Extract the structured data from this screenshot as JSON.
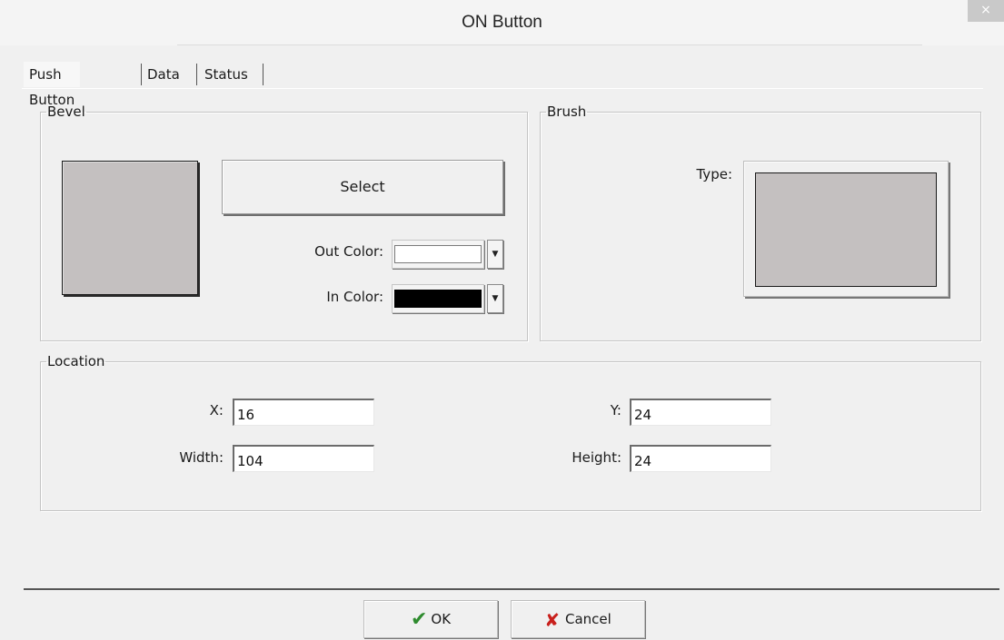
{
  "window": {
    "title": "ON Button",
    "close_glyph": "×"
  },
  "tabs": [
    {
      "label": "Push Button",
      "active": true
    },
    {
      "label": "Data",
      "active": false
    },
    {
      "label": "Status",
      "active": false
    }
  ],
  "bevel": {
    "legend": "Bevel",
    "select_label": "Select",
    "out_color_label": "Out Color:",
    "in_color_label": "In Color:",
    "out_color": "#ffffff",
    "in_color": "#000000",
    "preview_color": "#c4c0c0"
  },
  "brush": {
    "legend": "Brush",
    "type_label": "Type:",
    "type_color": "#c4c0c0"
  },
  "location": {
    "legend": "Location",
    "x_label": "X:",
    "x_value": "16",
    "y_label": "Y:",
    "y_value": "24",
    "width_label": "Width:",
    "width_value": "104",
    "height_label": "Height:",
    "height_value": "24"
  },
  "footer": {
    "ok_label": "OK",
    "cancel_label": "Cancel",
    "ok_icon": "checkmark-icon",
    "cancel_icon": "x-icon"
  }
}
